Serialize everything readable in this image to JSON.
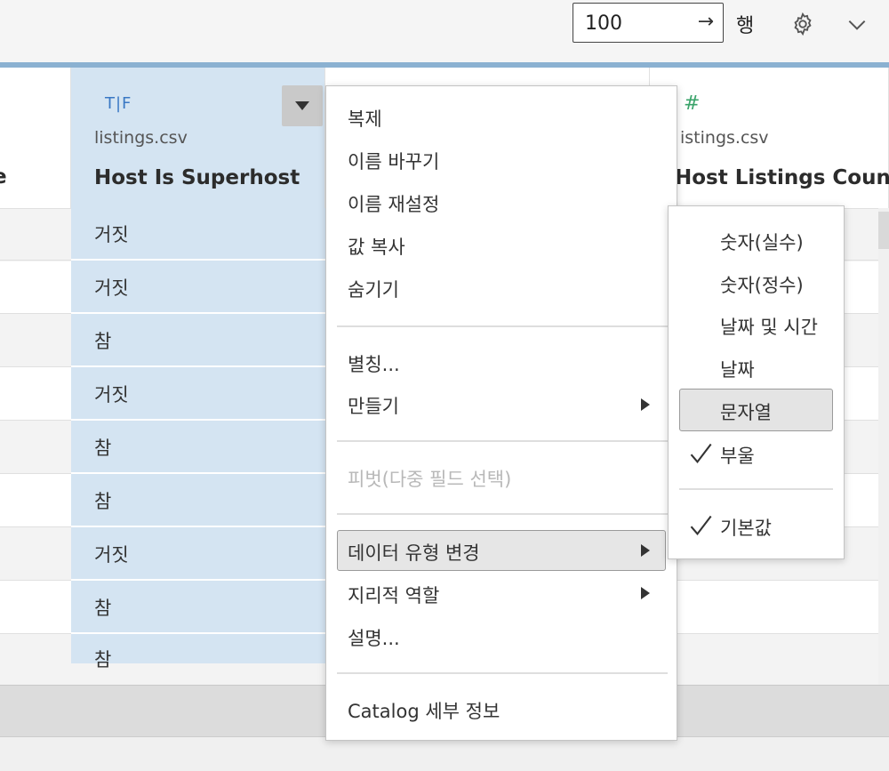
{
  "toolbar": {
    "rows_value": "100",
    "rows_arrow": "→",
    "rows_label": "행"
  },
  "columns": {
    "prev_partial_title": "e",
    "b": {
      "type_label": "T|F",
      "source": "listings.csv",
      "title": "Host Is Superhost"
    },
    "d": {
      "type_label": "#",
      "source": "istings.csv",
      "title": "Host Listings Count"
    }
  },
  "rows": [
    "거짓",
    "거짓",
    "참",
    "거짓",
    "참",
    "참",
    "거짓",
    "참",
    "참"
  ],
  "context_menu": {
    "items": [
      "복제",
      "이름 바꾸기",
      "이름 재설정",
      "값 복사",
      "숨기기",
      "별칭...",
      "만들기",
      "피벗(다중 필드 선택)",
      "데이터 유형 변경",
      "지리적 역할",
      "설명...",
      "Catalog 세부 정보"
    ]
  },
  "submenu": {
    "items": [
      "숫자(실수)",
      "숫자(정수)",
      "날짜 및 시간",
      "날짜",
      "문자열",
      "부울",
      "기본값"
    ],
    "checked": [
      "부울",
      "기본값"
    ],
    "highlighted": "문자열"
  },
  "colors": {
    "accent_bar": "#8bb1d1",
    "selected_column": "#d4e4f2",
    "type_blue": "#3a78c4",
    "type_green": "#3aa36a"
  }
}
